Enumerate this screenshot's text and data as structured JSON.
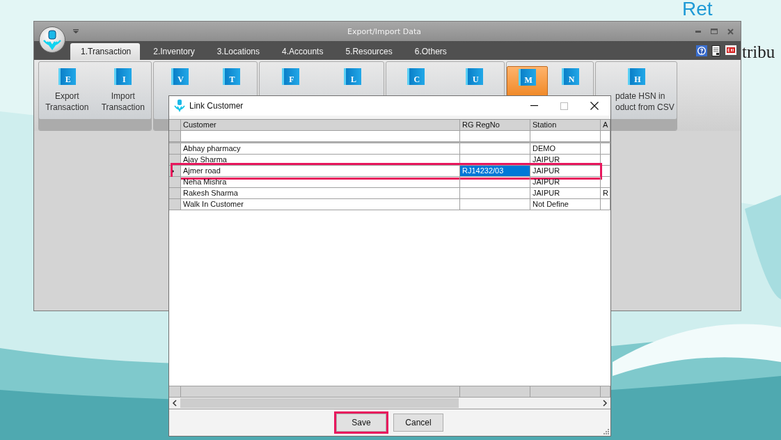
{
  "background": {
    "logo_text": "Ret",
    "tagline": "tribu"
  },
  "app_window": {
    "title": "Export/Import Data",
    "tabs": [
      {
        "label": "1.Transaction",
        "selected": true
      },
      {
        "label": "2.Inventory",
        "selected": false
      },
      {
        "label": "3.Locations",
        "selected": false
      },
      {
        "label": "4.Accounts",
        "selected": false
      },
      {
        "label": "5.Resources",
        "selected": false
      },
      {
        "label": "6.Others",
        "selected": false
      }
    ],
    "ribbon_groups": [
      {
        "buttons": [
          {
            "icon_letter": "E",
            "label_lines": [
              "Export",
              "Transaction"
            ],
            "selected": false
          },
          {
            "icon_letter": "I",
            "label_lines": [
              "Import",
              "Transaction"
            ],
            "selected": false
          }
        ]
      },
      {
        "buttons": [
          {
            "icon_letter": "V",
            "selected": false
          },
          {
            "icon_letter": "T",
            "selected": false
          }
        ]
      },
      {
        "buttons": [
          {
            "icon_letter": "F",
            "selected": false
          },
          {
            "icon_letter": "L",
            "selected": false
          }
        ]
      },
      {
        "buttons": [
          {
            "icon_letter": "C",
            "selected": false
          },
          {
            "icon_letter": "U",
            "selected": false
          }
        ]
      },
      {
        "buttons": [
          {
            "icon_letter": "M",
            "selected": true
          },
          {
            "icon_letter": "N",
            "selected": false
          }
        ]
      },
      {
        "buttons": [
          {
            "icon_letter": "H",
            "label_lines": [
              "pdate HSN in",
              "oduct from CSV"
            ],
            "kind": "cut",
            "selected": false
          }
        ]
      }
    ]
  },
  "dialog": {
    "title": "Link Customer",
    "columns": [
      "Customer",
      "RG RegNo",
      "Station",
      "A"
    ],
    "rows": [
      {
        "cells": [
          "",
          "",
          "",
          ""
        ],
        "selected": false,
        "highlighted": false
      },
      {
        "cells": [
          "Abhay pharmacy",
          "",
          "DEMO",
          ""
        ],
        "selected": false,
        "highlighted": false
      },
      {
        "cells": [
          "Ajay Sharma",
          "",
          "JAIPUR",
          ""
        ],
        "selected": false,
        "highlighted": false
      },
      {
        "cells": [
          "Ajmer road",
          "RJ14232/03",
          "JAIPUR",
          ""
        ],
        "selected": true,
        "highlighted": true
      },
      {
        "cells": [
          "Neha Mishra",
          "",
          "JAIPUR",
          ""
        ],
        "selected": false,
        "highlighted": false
      },
      {
        "cells": [
          "Rakesh Sharma",
          "",
          "JAIPUR",
          "R"
        ],
        "selected": false,
        "highlighted": false
      },
      {
        "cells": [
          "Walk In Customer",
          "",
          "Not Define",
          ""
        ],
        "selected": false,
        "highlighted": false
      }
    ],
    "buttons": [
      {
        "label": "Save",
        "highlighted": true
      },
      {
        "label": "Cancel",
        "highlighted": false
      }
    ]
  }
}
